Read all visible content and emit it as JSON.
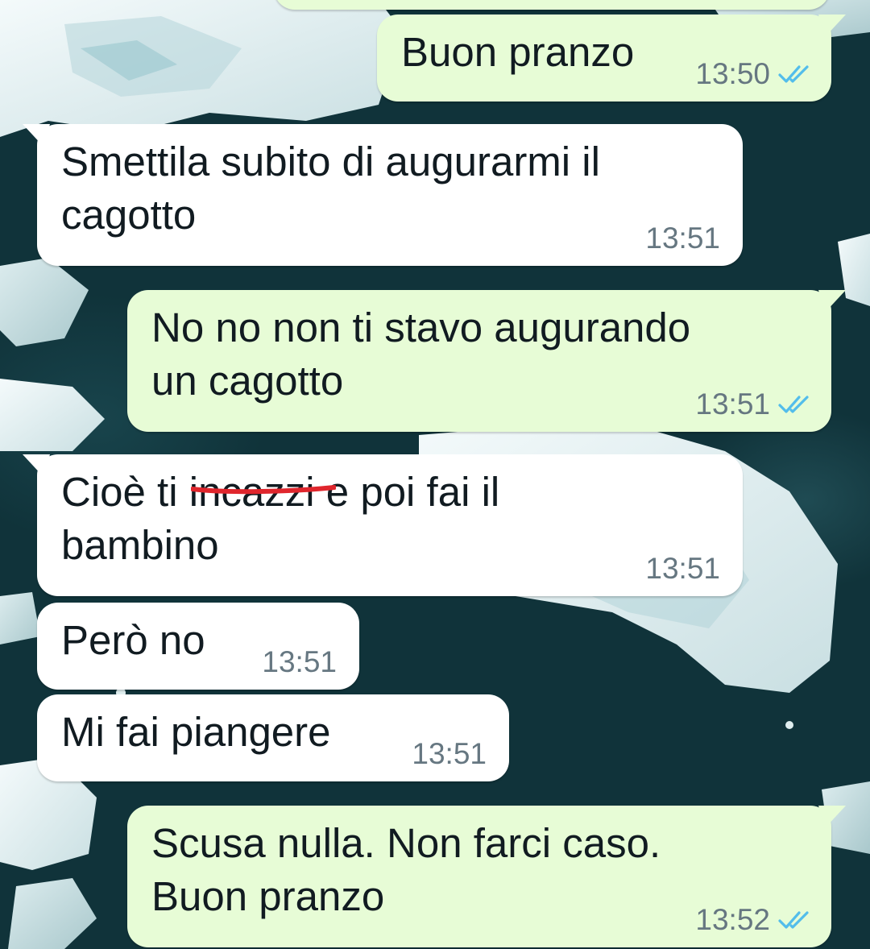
{
  "chat": {
    "messages": [
      {
        "direction": "out",
        "text": "Buon pranzo",
        "time": "13:50",
        "status": "read"
      },
      {
        "direction": "in",
        "text": "Smettila subito di augurarmi il\ncagotto",
        "time": "13:51"
      },
      {
        "direction": "out",
        "text": "No no non ti stavo augurando\nun cagotto",
        "time": "13:51",
        "status": "read"
      },
      {
        "direction": "in",
        "text_before": "Cioè ti ",
        "text_flagged": "incazzi",
        "text_after": " e poi fai il\nbambino",
        "time": "13:51",
        "spellcheck_color": "#e0262d"
      },
      {
        "direction": "in",
        "text": "Però no",
        "time": "13:51"
      },
      {
        "direction": "in",
        "text": "Mi fai piangere",
        "time": "13:51"
      },
      {
        "direction": "out",
        "text": "Scusa nulla. Non farci caso.\nBuon pranzo",
        "time": "13:52",
        "status": "read"
      }
    ]
  },
  "colors": {
    "incoming_bubble": "#ffffff",
    "outgoing_bubble": "#e7fcd6",
    "read_ticks": "#53bdeb",
    "wallpaper_water": "#10333a",
    "wallpaper_ice": "#e6f1f2"
  },
  "icons": {
    "read_receipt": "double-check-icon"
  }
}
